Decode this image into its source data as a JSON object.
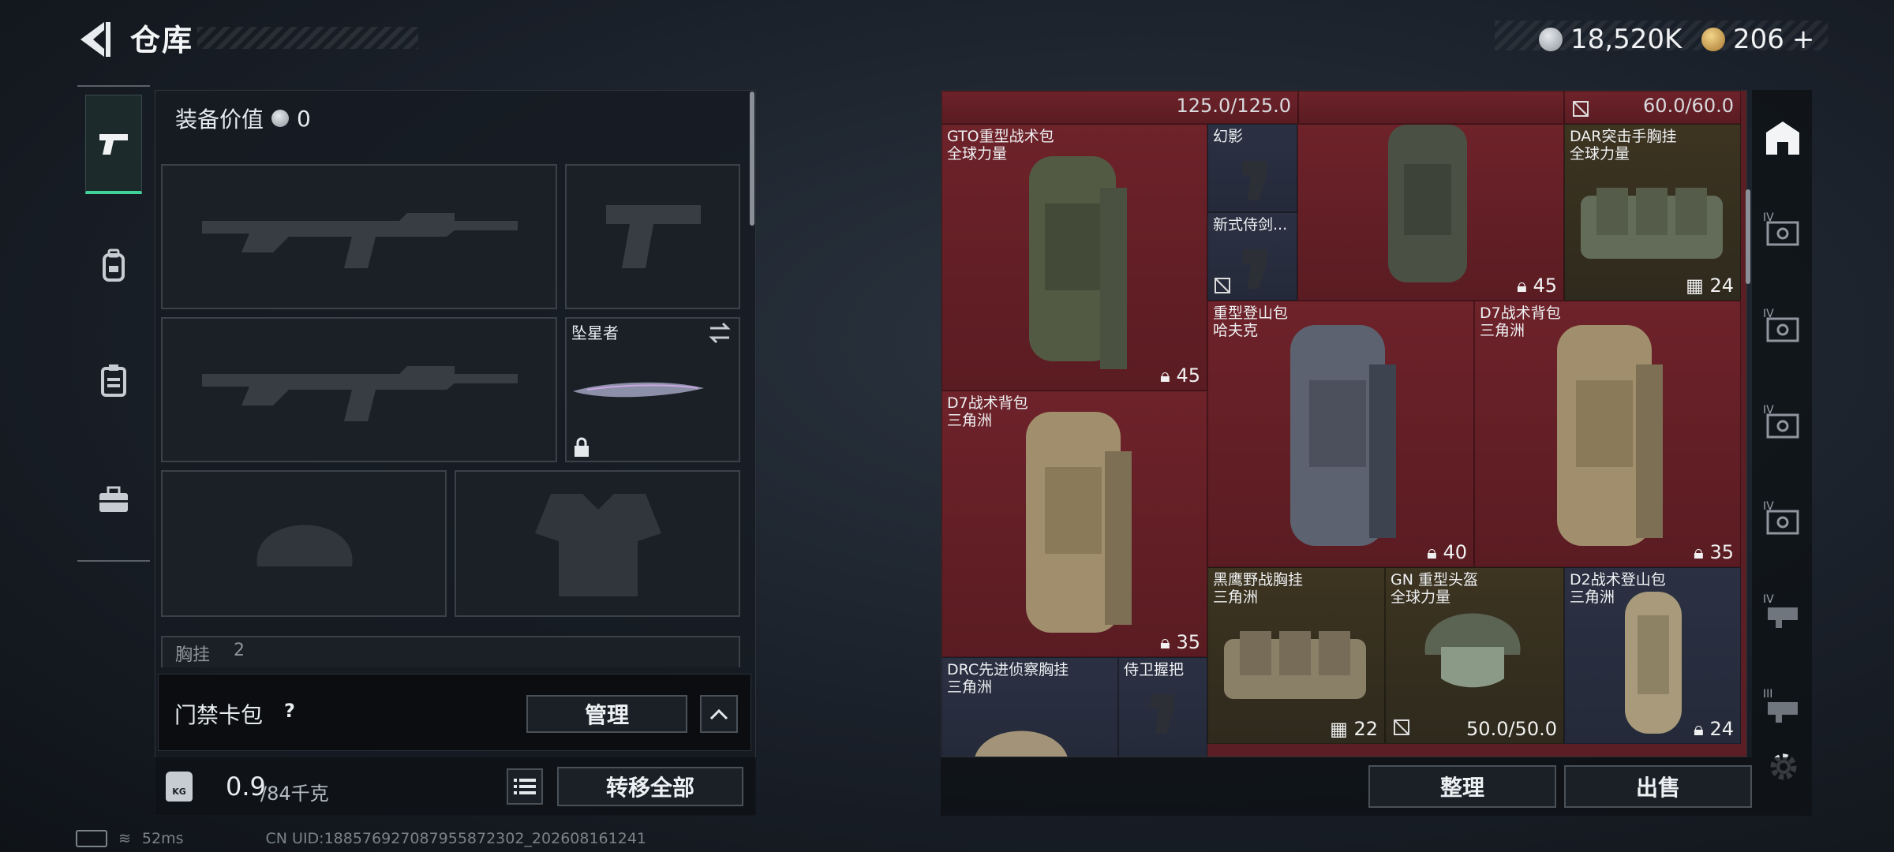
{
  "header": {
    "title": "仓库"
  },
  "currency": {
    "coins": "18,520K",
    "tokens": "206",
    "plus": "+"
  },
  "equipment": {
    "value_label": "装备价值",
    "value": "0",
    "melee_name": "坠星者",
    "chest_label": "胸挂",
    "chest_value": "2"
  },
  "keycard": {
    "label": "门禁卡包",
    "help": "?",
    "manage": "管理"
  },
  "weight": {
    "current": "0.9",
    "max": "/84千克",
    "badge": "KG",
    "transfer_all": "转移全部"
  },
  "grid": {
    "top_left_dur": "125.0/125.0",
    "top_right_dur": "60.0/60.0",
    "items": [
      {
        "id": "gto",
        "name1": "GTO重型战术包",
        "name2": "全球力量",
        "count": "45"
      },
      {
        "id": "phantom",
        "name1": "幻影",
        "name2": "",
        "count": ""
      },
      {
        "id": "samurai",
        "name1": "新式侍剑...",
        "name2": "",
        "count": ""
      },
      {
        "id": "pack-top",
        "name1": "",
        "name2": "",
        "count": "45"
      },
      {
        "id": "dar",
        "name1": "DAR突击手胸挂",
        "name2": "全球力量",
        "count": "24"
      },
      {
        "id": "heavy-mountain",
        "name1": "重型登山包",
        "name2": "哈夫克",
        "count": "40"
      },
      {
        "id": "d7-right",
        "name1": "D7战术背包",
        "name2": "三角洲",
        "count": "35"
      },
      {
        "id": "d7-left",
        "name1": "D7战术背包",
        "name2": "三角洲",
        "count": "35"
      },
      {
        "id": "black-eagle",
        "name1": "黑鹰野战胸挂",
        "name2": "三角洲",
        "count": "22"
      },
      {
        "id": "gn-helmet",
        "name1": "GN 重型头盔",
        "name2": "全球力量",
        "dur": "50.0/50.0"
      },
      {
        "id": "d2",
        "name1": "D2战术登山包",
        "name2": "三角洲",
        "count": "24"
      },
      {
        "id": "drc",
        "name1": "DRC先进侦察胸挂",
        "name2": "三角洲",
        "count": ""
      },
      {
        "id": "guard-grip",
        "name1": "侍卫握把",
        "name2": "",
        "count": ""
      }
    ]
  },
  "rail": {
    "tier_labels": [
      "IV",
      "IV",
      "IV",
      "IV",
      "IV",
      "III"
    ]
  },
  "actions": {
    "sort": "整理",
    "sell": "出售"
  },
  "status": {
    "ping": "52ms",
    "uid": "CN UID:188576927087955872302_202608161241"
  },
  "colors": {
    "accent": "#3fd39a",
    "cell_red": "#6e222a",
    "cell_navy": "#2b3143",
    "cell_olive": "#3d3421"
  }
}
